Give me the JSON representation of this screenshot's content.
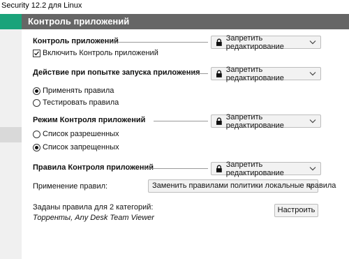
{
  "window": {
    "title": "Security 12.2 для Linux"
  },
  "header": {
    "title": "Контроль приложений"
  },
  "colors": {
    "accent": "#1aa37a",
    "header_bg": "#666666"
  },
  "lock_label": "Запретить редактирование",
  "sections": {
    "app_control": {
      "title": "Контроль приложений",
      "checkbox_label": "Включить Контроль приложений",
      "checked": true
    },
    "launch_action": {
      "title": "Действие при попытке запуска приложения",
      "options": [
        "Применять правила",
        "Тестировать правила"
      ],
      "selected": 0
    },
    "mode": {
      "title": "Режим Контроля приложений",
      "options": [
        "Список разрешенных",
        "Список запрещенных"
      ],
      "selected": 1
    },
    "rules": {
      "title": "Правила Контроля приложений",
      "apply_label": "Применение правил:",
      "apply_value": "Заменить правилами политики локальные правила",
      "defined_label": "Заданы правила для 2 категорий:",
      "categories": "Торренты, Any Desk Team Viewer",
      "configure_button": "Настроить"
    }
  }
}
